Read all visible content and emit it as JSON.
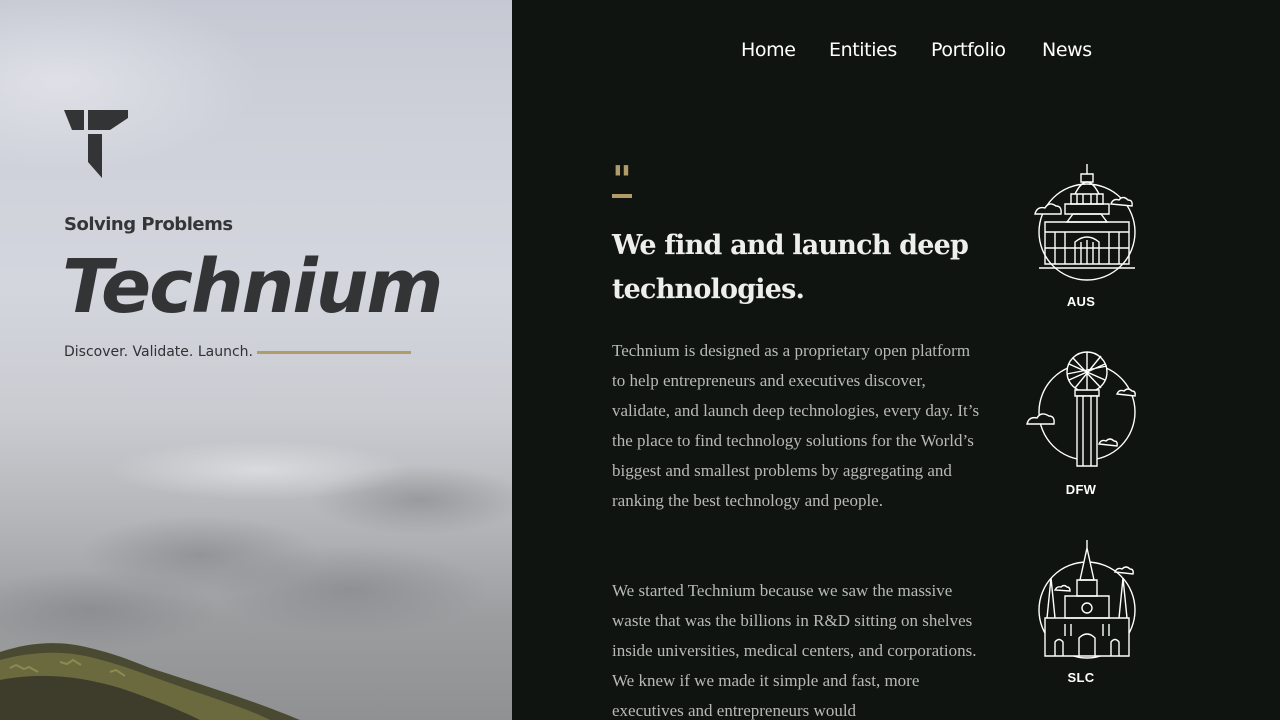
{
  "hero": {
    "kicker": "Solving Problems",
    "brand": "Technium",
    "subline": "Discover. Validate. Launch.",
    "accent_color": "#b19b68"
  },
  "nav": {
    "items": [
      {
        "label": "Home"
      },
      {
        "label": "Entities"
      },
      {
        "label": "Portfolio"
      },
      {
        "label": "News"
      }
    ]
  },
  "content": {
    "headline": "We find and launch deep technologies.",
    "paragraph_1": "Technium is designed as a proprietary open platform to help entrepreneurs and executives discover, validate, and launch deep technologies, every day. It’s the place to find technology solutions for the World’s biggest and smallest problems by aggregating and ranking the best technology and people.",
    "paragraph_2": "We started Technium because we saw the massive waste that was the billions in R&D sitting on shelves inside universities, medical centers, and corporations. We knew if we made it simple and fast, more executives and entrepreneurs would"
  },
  "cities": [
    {
      "label": "AUS",
      "icon": "austin-capitol-icon"
    },
    {
      "label": "DFW",
      "icon": "dallas-reunion-tower-icon"
    },
    {
      "label": "SLC",
      "icon": "salt-lake-cathedral-icon"
    }
  ]
}
